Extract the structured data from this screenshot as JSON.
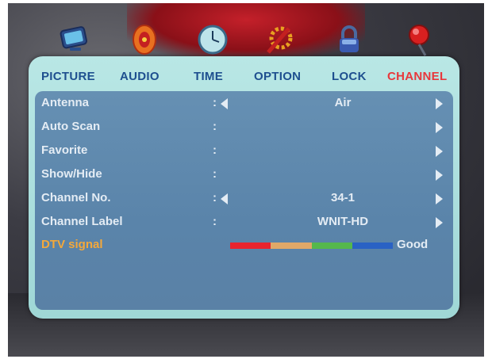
{
  "tabs": [
    {
      "label": "PICTURE",
      "icon": "monitor-icon"
    },
    {
      "label": "AUDIO",
      "icon": "speaker-icon"
    },
    {
      "label": "TIME",
      "icon": "clock-icon"
    },
    {
      "label": "OPTION",
      "icon": "tools-icon"
    },
    {
      "label": "LOCK",
      "icon": "padlock-icon"
    },
    {
      "label": "CHANNEL",
      "icon": "antenna-icon"
    }
  ],
  "active_tab": "CHANNEL",
  "colors": {
    "tab_text": "#1e4f8f",
    "active_tab": "#e8373b",
    "row_text": "#e4ecf4",
    "signal_label": "#f4a83a",
    "panel": "#b9e7e5",
    "menu_area": "#6690b3"
  },
  "rows": [
    {
      "label": "Antenna",
      "colon": ":",
      "value": "Air"
    },
    {
      "label": "Auto Scan",
      "colon": ":",
      "value": ""
    },
    {
      "label": "Favorite",
      "colon": ":",
      "value": ""
    },
    {
      "label": "Show/Hide",
      "colon": ":",
      "value": ""
    },
    {
      "label": "Channel No.",
      "colon": ":",
      "value": "34-1"
    },
    {
      "label": "Channel Label",
      "colon": ":",
      "value": "WNIT-HD"
    }
  ],
  "signal": {
    "label": "DTV signal",
    "quality": "Good",
    "segment_colors": [
      "#e8242e",
      "#e0a868",
      "#55b84c",
      "#2a62c4"
    ]
  }
}
